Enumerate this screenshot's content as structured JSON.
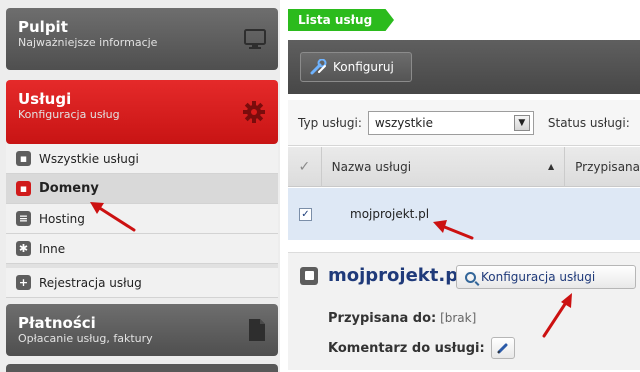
{
  "sidebar": {
    "pulpit": {
      "title": "Pulpit",
      "subtitle": "Najważniejsze informacje"
    },
    "uslugi": {
      "title": "Usługi",
      "subtitle": "Konfiguracja usług"
    },
    "items": [
      {
        "label": "Wszystkie usługi",
        "icon": "clipboard-icon",
        "active": false
      },
      {
        "label": "Domeny",
        "icon": "domain-icon",
        "active": true
      },
      {
        "label": "Hosting",
        "icon": "server-icon",
        "active": false
      },
      {
        "label": "Inne",
        "icon": "puzzle-icon",
        "active": false
      },
      {
        "label": "Rejestracja usług",
        "icon": "plus-icon",
        "active": false
      }
    ],
    "platnosci": {
      "title": "Płatności",
      "subtitle": "Opłacanie usług, faktury"
    }
  },
  "main": {
    "breadcrumb": "Lista usług",
    "toolbar": {
      "configure_label": "Konfiguruj"
    },
    "filters": {
      "type_label": "Typ usługi:",
      "type_value": "wszystkie",
      "status_label": "Status usługi:"
    },
    "table": {
      "columns": [
        "Nazwa usługi",
        "Przypisana"
      ],
      "rows": [
        {
          "checked": true,
          "name": "mojprojekt.pl"
        }
      ]
    },
    "detail": {
      "domain": "mojprojekt.pl",
      "configure_button": "Konfiguracja usługi",
      "assigned_label": "Przypisana do:",
      "assigned_value": "[brak]",
      "comment_label": "Komentarz do usługi:"
    }
  },
  "colors": {
    "accent_red": "#d01a1a",
    "breadcrumb_green": "#2bbb1d",
    "link_blue": "#1f3a7a",
    "annotation_arrow": "#cc1111"
  }
}
